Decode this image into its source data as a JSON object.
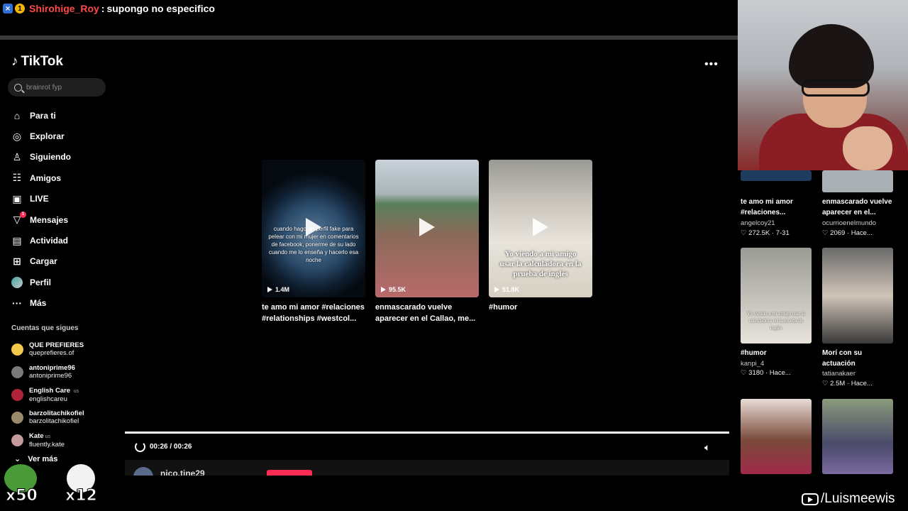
{
  "chat": {
    "badge1": "⨯",
    "badge2": "1",
    "username": "Shirohige_Roy",
    "separator": ":",
    "message": "supongo no especifico"
  },
  "tiktok": {
    "logo_text": "TikTok",
    "search_placeholder": "brainrot fyp",
    "nav": [
      {
        "label": "Para ti",
        "icon": "home-icon"
      },
      {
        "label": "Explorar",
        "icon": "compass-icon"
      },
      {
        "label": "Siguiendo",
        "icon": "user-follow-icon"
      },
      {
        "label": "Amigos",
        "icon": "friends-icon"
      },
      {
        "label": "LIVE",
        "icon": "live-icon"
      },
      {
        "label": "Mensajes",
        "icon": "send-icon",
        "badge": "1"
      },
      {
        "label": "Actividad",
        "icon": "activity-icon"
      },
      {
        "label": "Cargar",
        "icon": "upload-icon"
      },
      {
        "label": "Perfil",
        "icon": "avatar"
      },
      {
        "label": "Más",
        "icon": "more-icon"
      }
    ],
    "following_title": "Cuentas que sigues",
    "following": [
      {
        "name": "QUE PREFIERES",
        "tag": "",
        "handle": "queprefieres.of",
        "color": "#f2c94c"
      },
      {
        "name": "antoniprime96",
        "tag": "",
        "handle": "antoniprime96",
        "color": "#7a7a7a"
      },
      {
        "name": "English Care",
        "tag": "us",
        "handle": "englishcareu",
        "color": "#b0243a"
      },
      {
        "name": "barzolitachikofiel",
        "tag": "",
        "handle": "barzolitachikofiel",
        "color": "#9a8a6a"
      },
      {
        "name": "Kate",
        "tag": "us",
        "handle": "fluently.kate",
        "color": "#c49a9a"
      }
    ],
    "see_more": "Ver más",
    "more_options": "•••",
    "cards": [
      {
        "caption": "cuando hago un perfil fake para pelear con mi mujer en comentarios de facebook, ponerme de su lado cuando me lo enseña y hacerlo esa noche",
        "views": "1.4M",
        "title": "te amo mi amor #relaciones #relationships #westcol..."
      },
      {
        "caption": "",
        "views": "95.5K",
        "title": "enmascarado vuelve aparecer en el Callao, me..."
      },
      {
        "caption": "Yo viendo a mi amigo usar la calculadora en la prueba de inglés",
        "views": "51.8K",
        "title": "#humor"
      }
    ],
    "player": {
      "time": "00:26 / 00:26",
      "author": "nico.tine29"
    },
    "suggested": [
      {
        "title": "te amo mi amor #relaciones...",
        "author": "angelcoy21",
        "stats": "♡ 272.5K · 7-31"
      },
      {
        "title": "enmascarado vuelve aparecer en el...",
        "author": "ocurrioenelmundo",
        "stats": "♡ 2069 · Hace..."
      },
      {
        "title": "#humor",
        "author": "kanpi_4",
        "stats": "♡ 3180 · Hace...",
        "caption": "Yo viendo a mi amigo usar la calculadora en la prueba de inglés"
      },
      {
        "title": "Morí con su actuación",
        "author": "tatianakaer",
        "stats": "♡ 2.5M · Hace..."
      }
    ]
  },
  "overlay": {
    "emote1_count": "x50",
    "emote2_count": "x12",
    "watermark": "/Luismeewis"
  }
}
